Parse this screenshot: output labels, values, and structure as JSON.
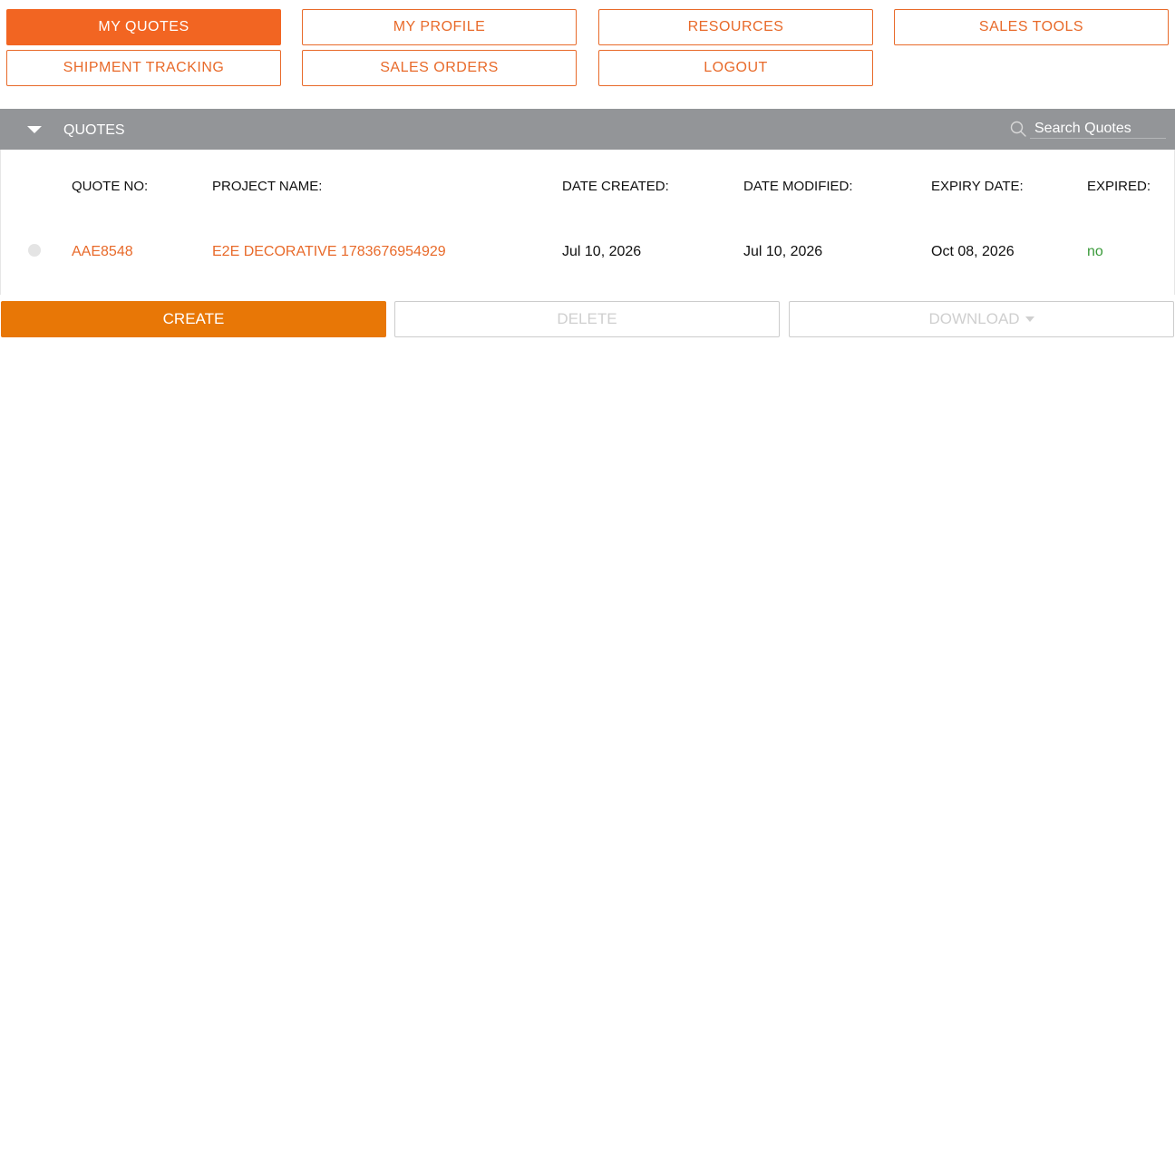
{
  "nav": {
    "items": [
      {
        "label": "MY QUOTES",
        "active": true
      },
      {
        "label": "MY PROFILE",
        "active": false
      },
      {
        "label": "RESOURCES",
        "active": false
      },
      {
        "label": "SALES TOOLS",
        "active": false
      },
      {
        "label": "SHIPMENT TRACKING",
        "active": false
      },
      {
        "label": "SALES ORDERS",
        "active": false
      },
      {
        "label": "LOGOUT",
        "active": false
      }
    ]
  },
  "quotes_panel": {
    "title": "QUOTES",
    "toggle_icon": "caret-down-icon",
    "search": {
      "placeholder": "Search Quotes",
      "value": "",
      "icon": "search-icon"
    }
  },
  "table": {
    "columns": [
      "QUOTE NO:",
      "PROJECT NAME:",
      "DATE CREATED:",
      "DATE MODIFIED:",
      "EXPIRY DATE:",
      "EXPIRED:"
    ],
    "rows": [
      {
        "selected": false,
        "quote_no": "AAE8548",
        "project_name": "E2E DECORATIVE 1783676954929",
        "date_created": "Jul 10, 2026",
        "date_modified": "Jul 10, 2026",
        "expiry_date": "Oct 08, 2026",
        "expired": "no"
      }
    ]
  },
  "actions": {
    "create_label": "CREATE",
    "delete_label": "DELETE",
    "download_label": "DOWNLOAD",
    "download_icon": "caret-down-icon"
  },
  "colors": {
    "brand_orange": "#f26522",
    "create_orange": "#e87706",
    "bar_gray": "#939598",
    "status_green": "#3a9a3a",
    "disabled_gray": "#cfcfcf"
  }
}
